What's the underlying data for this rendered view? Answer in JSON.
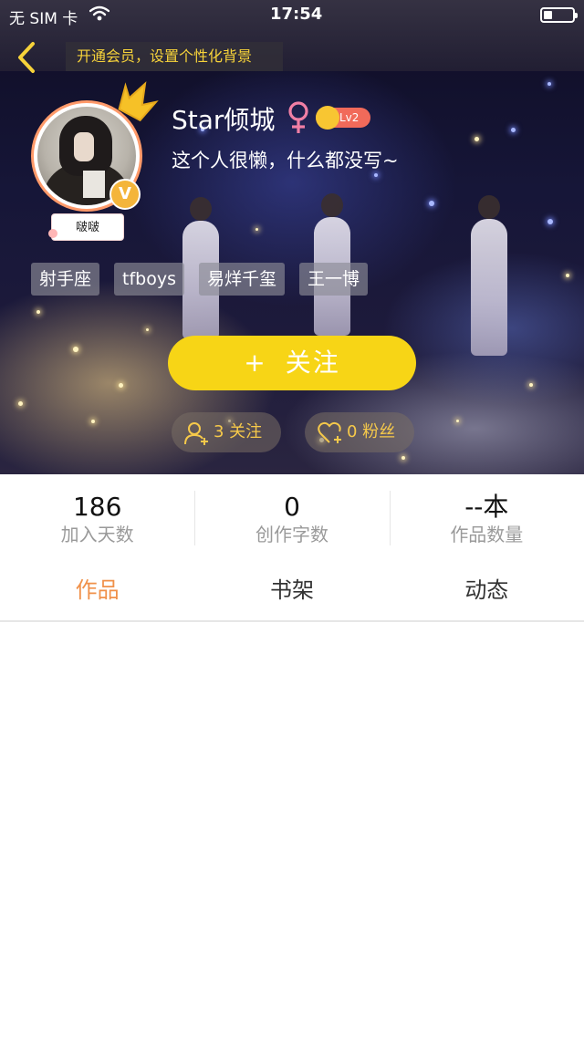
{
  "status_bar": {
    "carrier": "无 SIM 卡",
    "time": "17:54",
    "battery_level": 0.3
  },
  "header": {
    "vip_tip": "开通会员，设置个性化背景",
    "back_icon": "chevron-left-icon"
  },
  "profile": {
    "username": "Star倾城",
    "gender": "female",
    "level": "Lv2",
    "bio": "这个人很懒，什么都没写~",
    "avatar_badge": "V",
    "avatar_tag": "啵啵",
    "tags": [
      "射手座",
      "tfboys",
      "易烊千玺",
      "王一博"
    ]
  },
  "actions": {
    "follow_plus": "+",
    "follow_label": "关注",
    "following_count": "3 关注",
    "fans_count": "0 粉丝"
  },
  "stats": [
    {
      "value": "186",
      "label": "加入天数"
    },
    {
      "value": "0",
      "label": "创作字数"
    },
    {
      "value": "--本",
      "label": "作品数量"
    }
  ],
  "tabs": [
    {
      "label": "作品",
      "active": true
    },
    {
      "label": "书架",
      "active": false
    },
    {
      "label": "动态",
      "active": false
    }
  ],
  "colors": {
    "accent_yellow": "#f7d516",
    "tab_active": "#f0914a",
    "vip_tip_text": "#f6d23a",
    "level_badge": "#f16a5a"
  }
}
